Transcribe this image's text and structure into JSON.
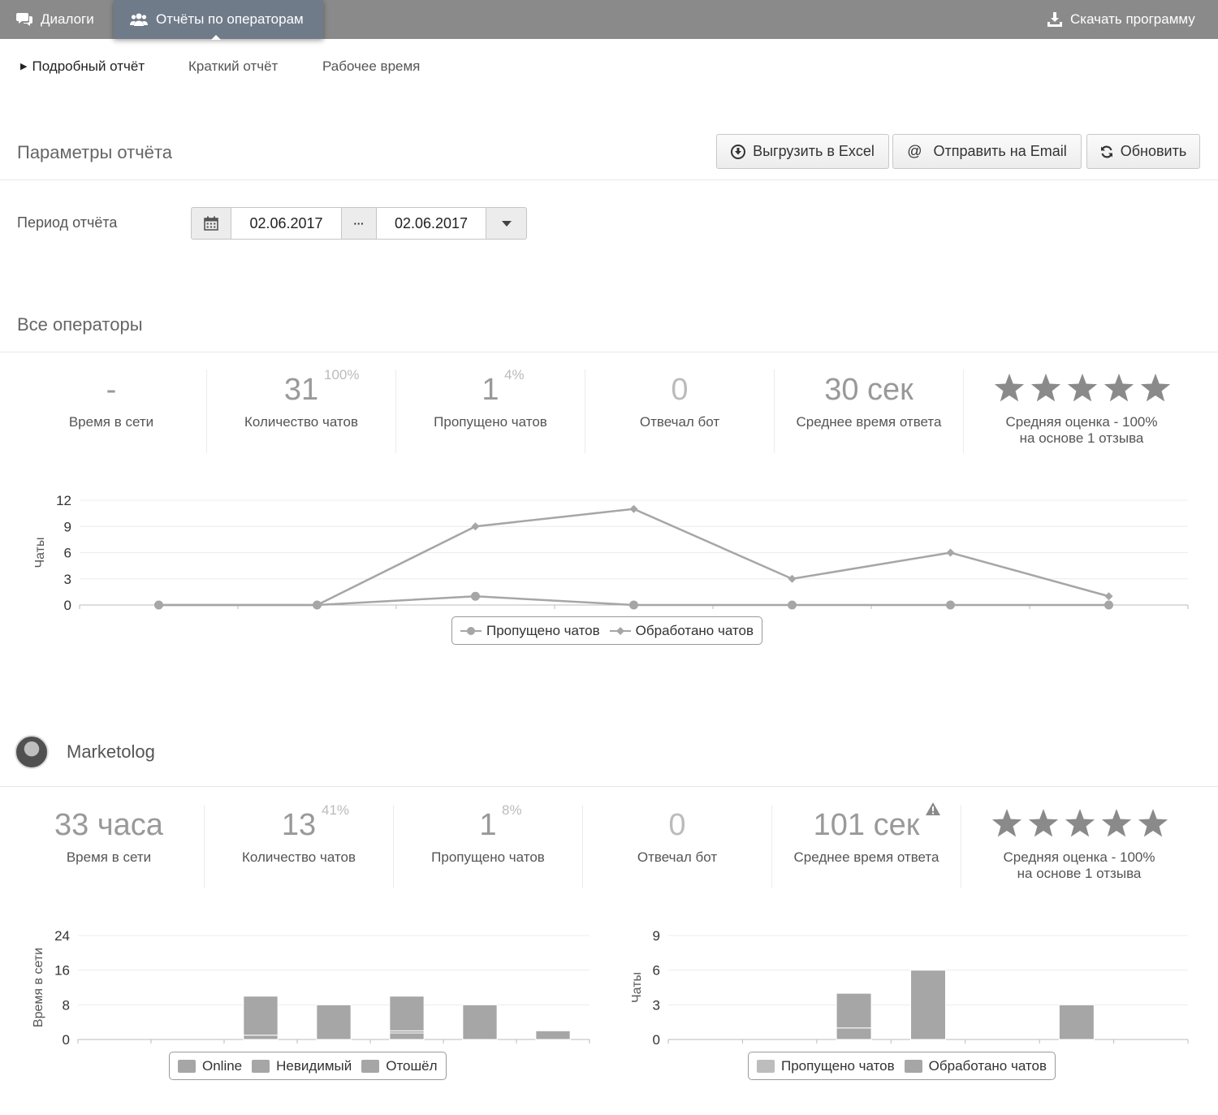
{
  "nav": {
    "dialogs_label": "Диалоги",
    "reports_label": "Отчёты по операторам",
    "download_label": "Скачать программу"
  },
  "subtabs": {
    "detailed": "Подробный отчёт",
    "short": "Краткий отчёт",
    "worktime": "Рабочее время"
  },
  "params": {
    "title": "Параметры отчёта",
    "excel_label": "Выгрузить в Excel",
    "email_label": "Отправить на Email",
    "refresh_label": "Обновить",
    "period_label": "Период отчёта",
    "date_from": "02.06.2017",
    "date_sep": "···",
    "date_to": "02.06.2017"
  },
  "all_operators": {
    "title": "Все операторы",
    "stats": {
      "online_value": "-",
      "online_label": "Время в сети",
      "chats_value": "31",
      "chats_pct": "100%",
      "chats_label": "Количество чатов",
      "missed_value": "1",
      "missed_pct": "4%",
      "missed_label": "Пропущено чатов",
      "bot_value": "0",
      "bot_label": "Отвечал бот",
      "avg_value": "30 сек",
      "avg_label": "Среднее время ответа",
      "rating_line1": "Средняя оценка - 100%",
      "rating_line2": "на основе 1 отзыва",
      "stars": 5
    }
  },
  "operator": {
    "name": "Marketolog",
    "stats": {
      "online_value": "33 часа",
      "online_label": "Время в сети",
      "chats_value": "13",
      "chats_pct": "41%",
      "chats_label": "Количество чатов",
      "missed_value": "1",
      "missed_pct": "8%",
      "missed_label": "Пропущено чатов",
      "bot_value": "0",
      "bot_label": "Отвечал бот",
      "avg_value": "101 сек",
      "avg_label": "Среднее время ответа",
      "rating_line1": "Средняя оценка - 100%",
      "rating_line2": "на основе 1 отзыва",
      "stars": 5
    }
  },
  "colors": {
    "topbar": "#8a8a8a",
    "active_tab": "#707b8a",
    "series": "#a6a6a6"
  },
  "chart_data": [
    {
      "type": "line",
      "ylabel": "Чаты",
      "yticks": [
        0,
        3,
        6,
        9,
        12
      ],
      "ylim": [
        0,
        12
      ],
      "grid": true,
      "legend_position": "bottom",
      "x": [
        1,
        2,
        3,
        4,
        5,
        6,
        7
      ],
      "series": [
        {
          "name": "Пропущено чатов",
          "marker": "circle",
          "values": [
            0,
            0,
            1,
            0,
            0,
            0,
            0
          ]
        },
        {
          "name": "Обработано чатов",
          "marker": "diamond",
          "values": [
            0,
            0,
            9,
            11,
            3,
            6,
            1
          ]
        }
      ]
    },
    {
      "type": "bar",
      "stacked": true,
      "ylabel": "Время в сети",
      "yticks": [
        0,
        8,
        16,
        24
      ],
      "ylim": [
        0,
        24
      ],
      "grid": true,
      "legend_position": "bottom",
      "categories": [
        1,
        2,
        3,
        4,
        5,
        6,
        7
      ],
      "series": [
        {
          "name": "Online",
          "values": [
            0,
            0,
            1,
            8,
            1.5,
            8,
            2
          ]
        },
        {
          "name": "Невидимый",
          "values": [
            0,
            0,
            0,
            0,
            0.5,
            0,
            0
          ]
        },
        {
          "name": "Отошёл",
          "values": [
            0,
            0,
            9,
            0,
            8,
            0,
            0
          ]
        }
      ]
    },
    {
      "type": "bar",
      "stacked": true,
      "ylabel": "Чаты",
      "yticks": [
        0,
        3,
        6,
        9
      ],
      "ylim": [
        0,
        9
      ],
      "grid": true,
      "legend_position": "bottom",
      "categories": [
        1,
        2,
        3,
        4,
        5,
        6,
        7
      ],
      "series": [
        {
          "name": "Пропущено чатов",
          "values": [
            0,
            0,
            1,
            0,
            0,
            0,
            0
          ]
        },
        {
          "name": "Обработано чатов",
          "values": [
            0,
            0,
            3,
            6,
            0,
            3,
            0
          ]
        }
      ]
    }
  ]
}
